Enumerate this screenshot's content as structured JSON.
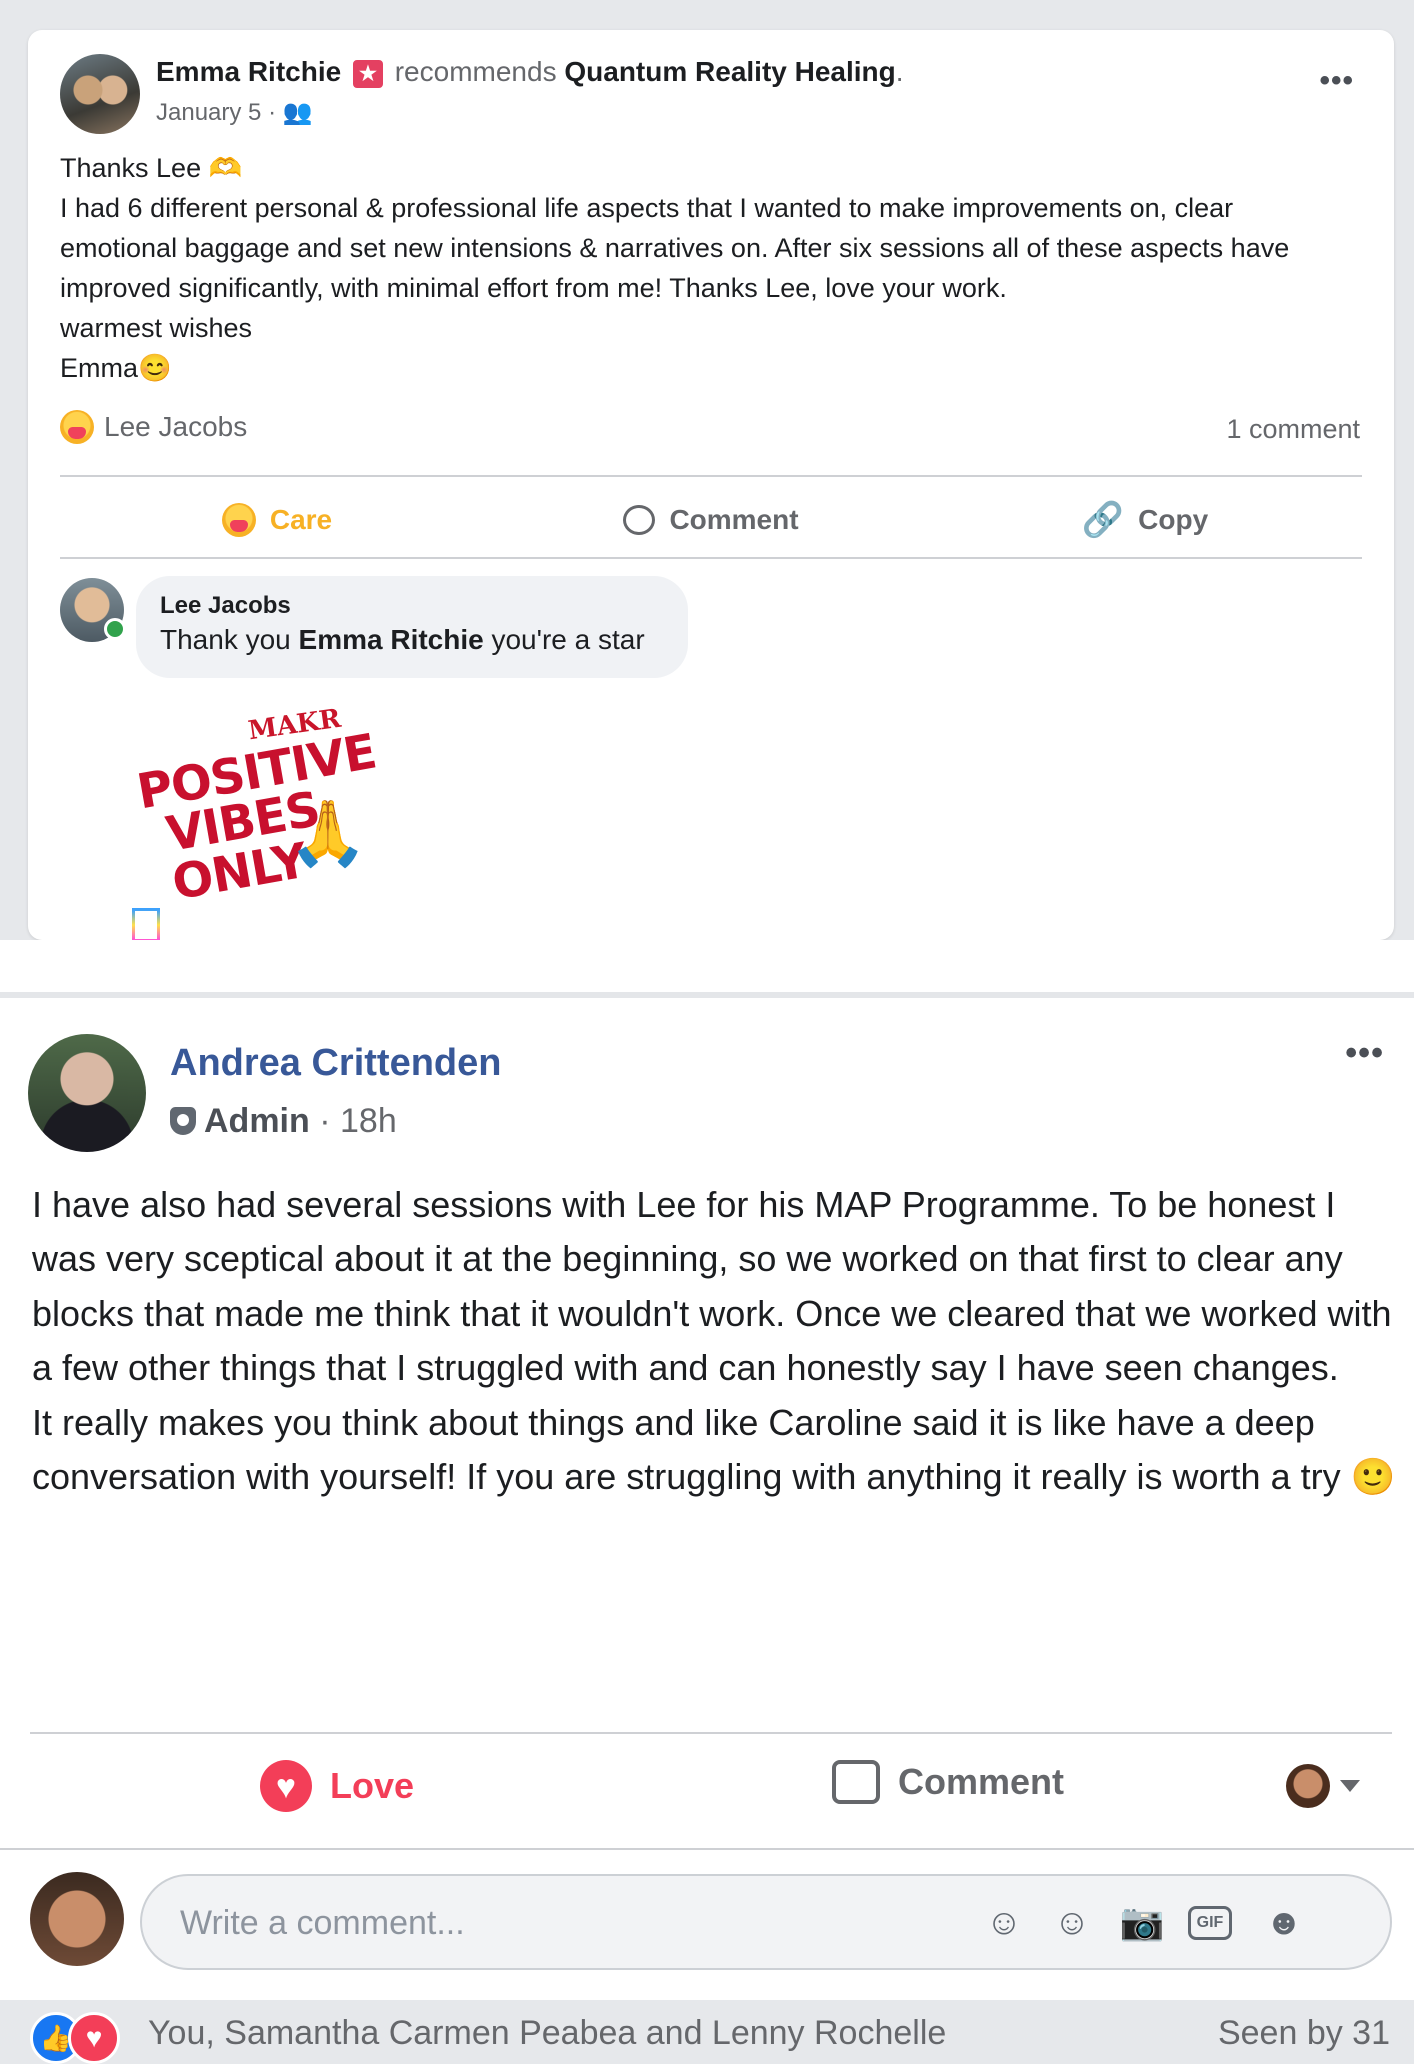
{
  "post1": {
    "author": "Emma Ritchie",
    "recommends_word": "recommends",
    "page": "Quantum Reality Healing",
    "date": "January 5 ·",
    "audience_icon": "friends-icon",
    "body": [
      "Thanks Lee 🫶",
      "I had 6 different personal & professional life aspects that I wanted to make improvements on, clear emotional baggage and set new intensions & narratives on. After six sessions all of these aspects have improved significantly, with minimal effort from me! Thanks Lee, love your work.",
      "warmest wishes",
      "Emma😊"
    ],
    "reactor": "Lee Jacobs",
    "comment_count": "1 comment",
    "actions": {
      "care": "Care",
      "comment": "Comment",
      "copy": "Copy"
    },
    "comment": {
      "author": "Lee Jacobs",
      "text_before": "Thank you",
      "mention": "Emma Ritchie",
      "text_after": "you're a star"
    },
    "sticker": {
      "top": "MAKR",
      "line1": "POSITIVE",
      "line2": "VIBES",
      "line3": "ONLY",
      "hands": "🙏"
    }
  },
  "post2": {
    "author": "Andrea Crittenden",
    "role": "Admin",
    "time": "· 18h",
    "body": [
      "I have also had several sessions with Lee for his MAP Programme. To be honest I was very sceptical about it at the beginning, so we worked on that first to clear any blocks that made me think that it wouldn't work. Once we cleared that we worked with a few other things that I struggled with and can honestly say I have seen changes.",
      "It really makes you think about things and like Caroline said it is like have a deep conversation with yourself! If you are struggling with anything it really is worth a try 🙂"
    ],
    "reactors": "You, Samantha Carmen Peabea and Lenny Rochelle",
    "seen": "Seen by 31",
    "actions": {
      "love": "Love",
      "comment": "Comment"
    },
    "comment_placeholder": "Write a comment...",
    "input_icons": [
      "avatar-sticker-icon",
      "emoji-icon",
      "camera-icon",
      "gif-icon",
      "sticker-icon"
    ],
    "gif_label": "GIF"
  },
  "colors": {
    "care": "#f7b125",
    "love": "#f33e58",
    "link_name": "#385898",
    "like": "#1877f2",
    "secondary_text": "#65676b"
  }
}
